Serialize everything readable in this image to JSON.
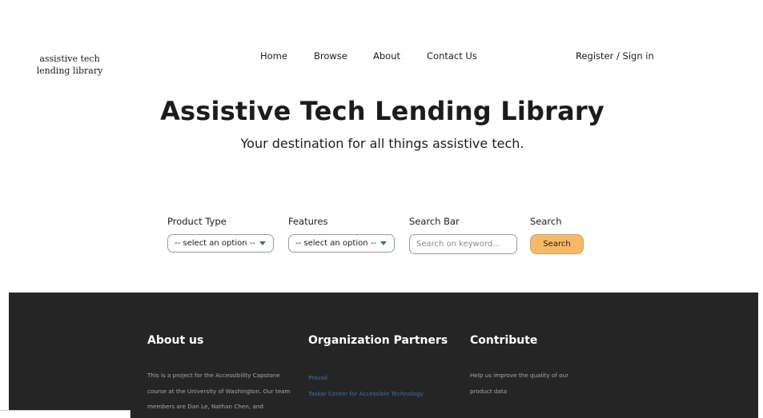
{
  "header": {
    "logo_line1": "assistive tech",
    "logo_line2": "lending library",
    "nav": {
      "home": "Home",
      "browse": "Browse",
      "about": "About",
      "contact": "Contact Us",
      "auth": "Register / Sign in"
    }
  },
  "hero": {
    "title": "Assistive Tech Lending Library",
    "subtitle": "Your destination for all things assistive tech."
  },
  "filters": {
    "product_type_label": "Product Type",
    "product_type_value": "-- select an option --",
    "features_label": "Features",
    "features_value": "-- select an option --",
    "search_bar_label": "Search Bar",
    "search_placeholder": "Search on keyword...",
    "search_label": "Search",
    "search_button": "Search",
    "accent_color": "#f7b966",
    "arrow_color": "#2b6fa8"
  },
  "footer": {
    "background": "#252525",
    "about": {
      "heading": "About us",
      "text": "This is a project for the Accessibility Capstone course at the University of Washington. Our team members are Dan Le, Nathan Chen, and"
    },
    "partners": {
      "heading": "Organization Partners",
      "links": [
        "Provail",
        "Taskar Center for Accessible Technology"
      ]
    },
    "contribute": {
      "heading": "Contribute",
      "text": "Help us improve the quality of our product data"
    }
  }
}
